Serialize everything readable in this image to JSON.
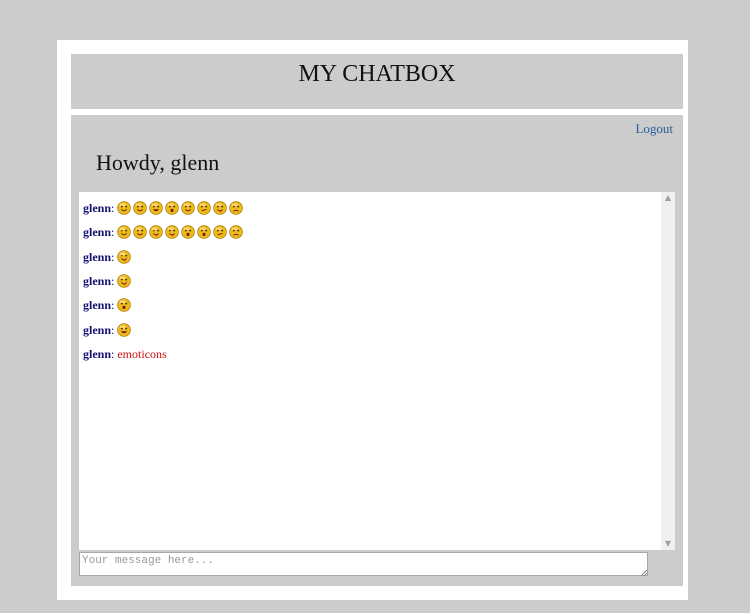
{
  "header": {
    "title": "MY CHATBOX"
  },
  "panel": {
    "logout_label": "Logout",
    "greeting": "Howdy, glenn"
  },
  "messages": [
    {
      "user": "glenn",
      "separator": ":",
      "emoticons": [
        "smile",
        "happy",
        "grin",
        "surprised",
        "blush",
        "smirk",
        "tongue",
        "sad"
      ],
      "text": ""
    },
    {
      "user": "glenn",
      "separator": ":",
      "emoticons": [
        "wink",
        "happy",
        "wink-tongue",
        "tongue-out",
        "surprised",
        "shocked",
        "confused",
        "angry"
      ],
      "text": ""
    },
    {
      "user": "glenn",
      "separator": ":",
      "emoticons": [
        "wink-tongue"
      ],
      "text": ""
    },
    {
      "user": "glenn",
      "separator": ":",
      "emoticons": [
        "tongue-out"
      ],
      "text": ""
    },
    {
      "user": "glenn",
      "separator": ":",
      "emoticons": [
        "surprised-tongue"
      ],
      "text": ""
    },
    {
      "user": "glenn",
      "separator": ":",
      "emoticons": [
        "big-smile"
      ],
      "text": ""
    },
    {
      "user": "glenn",
      "separator": ":",
      "emoticons": [],
      "text": "emoticons"
    }
  ],
  "composer": {
    "placeholder": "Your message here..."
  },
  "colors": {
    "username": "#11116e",
    "message_text": "#cc1010",
    "link": "#2a5d9a",
    "emoticon_fill": "#f2b81e"
  }
}
